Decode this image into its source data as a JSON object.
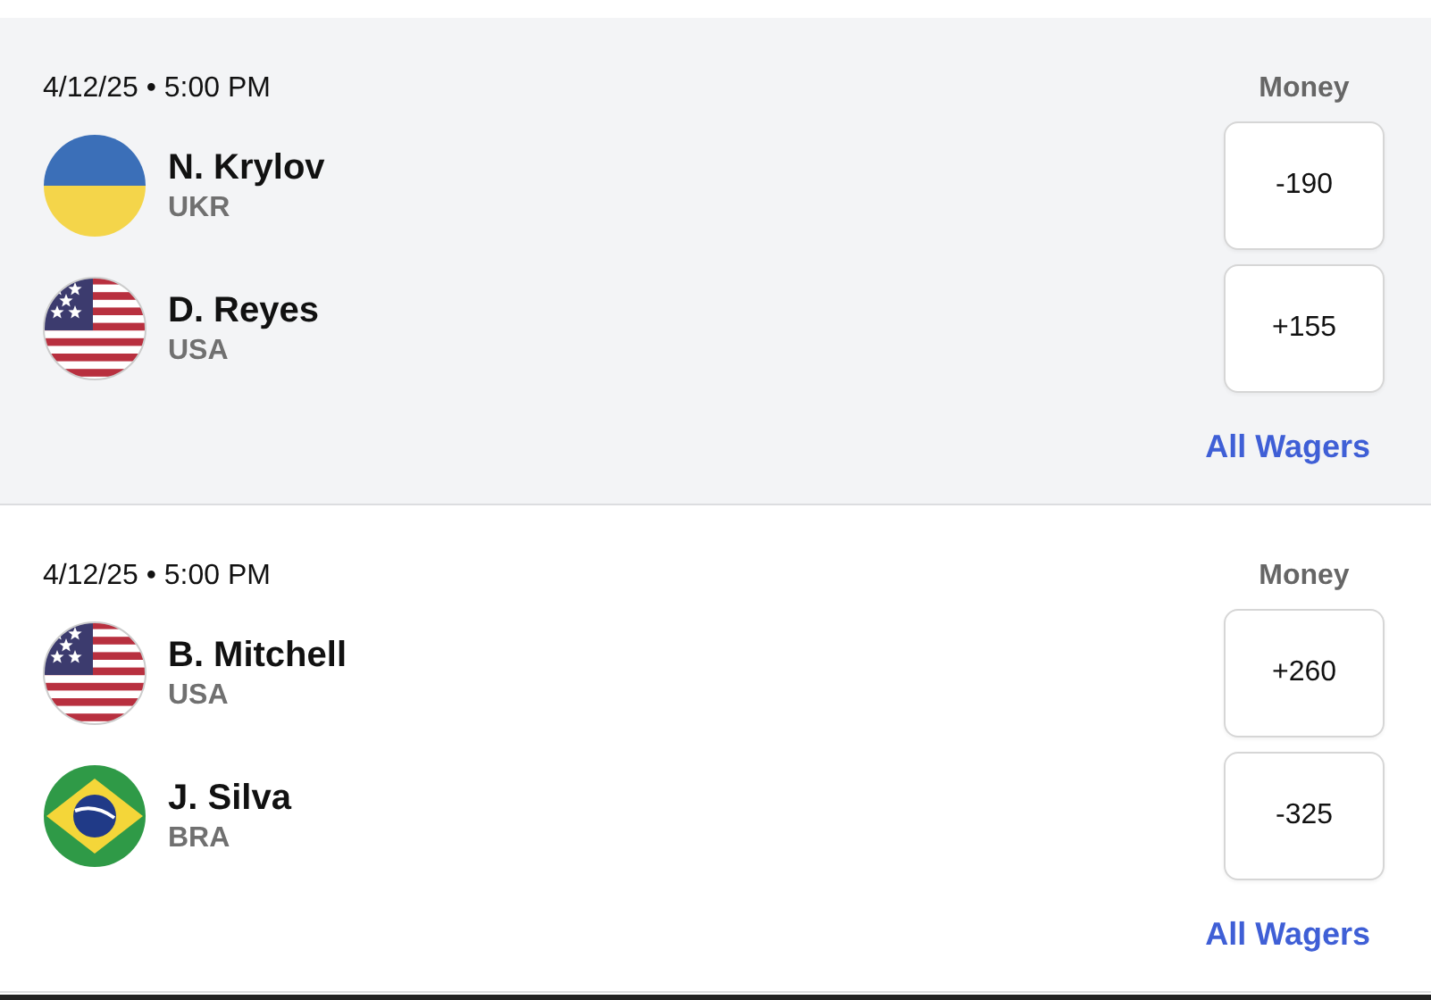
{
  "matches": [
    {
      "date": "4/12/25 • 5:00 PM",
      "market": "Money",
      "highlighted": true,
      "link": "All Wagers",
      "players": [
        {
          "name": "N. Krylov",
          "country": "UKR",
          "kind": "ukr",
          "odds": "-190"
        },
        {
          "name": "D. Reyes",
          "country": "USA",
          "kind": "usa",
          "odds": "+155"
        }
      ]
    },
    {
      "date": "4/12/25 • 5:00 PM",
      "market": "Money",
      "highlighted": false,
      "link": "All Wagers",
      "players": [
        {
          "name": "B. Mitchell",
          "country": "USA",
          "kind": "usa",
          "odds": "+260"
        },
        {
          "name": "J. Silva",
          "country": "BRA",
          "kind": "bra",
          "odds": "-325"
        }
      ]
    }
  ]
}
